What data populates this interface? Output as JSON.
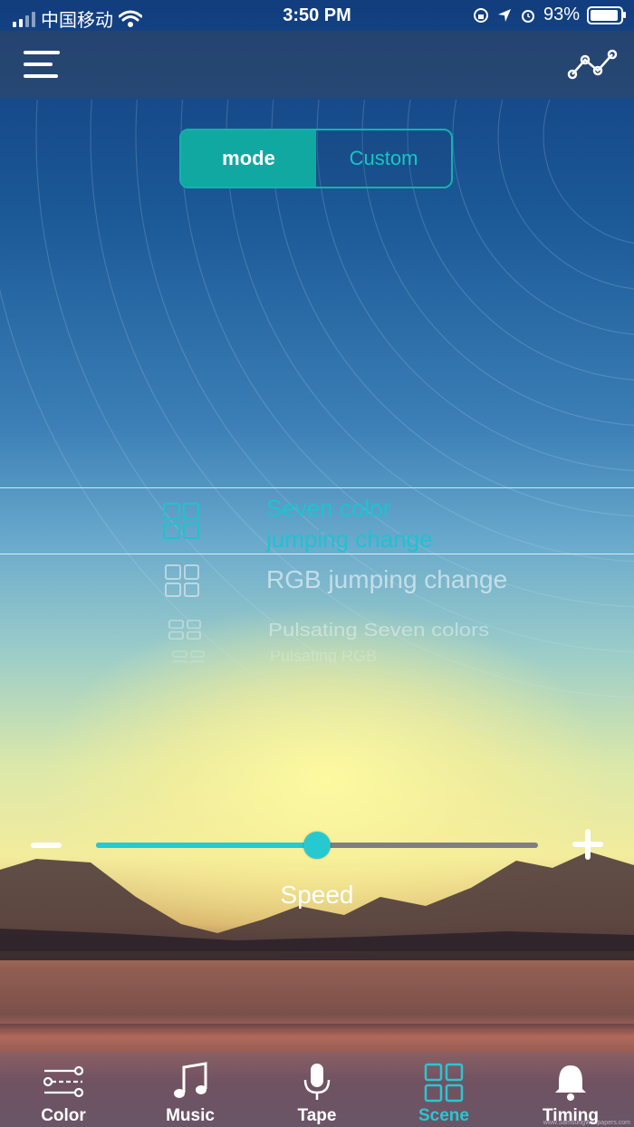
{
  "status_bar": {
    "carrier": "中国移动",
    "time": "3:50 PM",
    "battery": "93%",
    "battery_level": 0.93
  },
  "header": {
    "menu_icon": "hamburger-menu-icon",
    "graph_icon": "line-graph-icon"
  },
  "segment": {
    "mode_label": "mode",
    "custom_label": "Custom",
    "selected": "mode"
  },
  "picker": {
    "items": [
      {
        "line1": "Seven color",
        "line2": "jumping change"
      },
      {
        "line1": "RGB jumping change"
      },
      {
        "line1": "Pulsating Seven colors"
      },
      {
        "line1": "Pulsating RGB"
      }
    ],
    "selected_index": 0,
    "selected_color": "#1ec3cf"
  },
  "speed": {
    "label": "Speed",
    "value": 0.5,
    "accent": "#27c9d0"
  },
  "tabs": [
    {
      "label": "Color",
      "icon": "sliders-icon"
    },
    {
      "label": "Music",
      "icon": "music-note-icon"
    },
    {
      "label": "Tape",
      "icon": "microphone-icon"
    },
    {
      "label": "Scene",
      "icon": "grid-icon",
      "active": true
    },
    {
      "label": "Timing",
      "icon": "bell-icon"
    }
  ],
  "watermark": "www.SamsungWallpapers.com"
}
